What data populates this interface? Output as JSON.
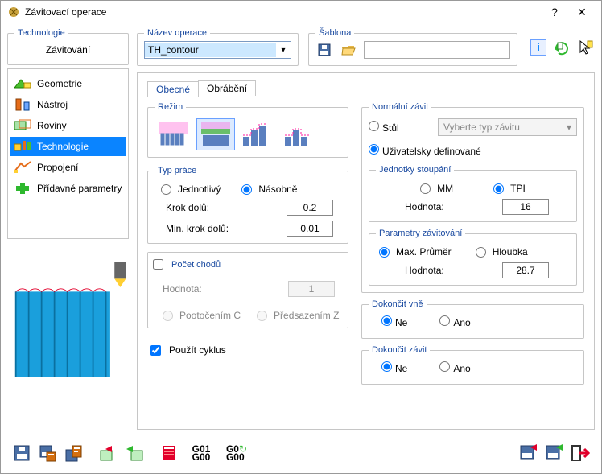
{
  "window": {
    "title": "Závitovací operace"
  },
  "tech_group": {
    "legend": "Technologie",
    "label": "Závitování"
  },
  "tree": {
    "items": [
      {
        "label": "Geometrie"
      },
      {
        "label": "Nástroj"
      },
      {
        "label": "Roviny"
      },
      {
        "label": "Technologie"
      },
      {
        "label": "Propojení"
      },
      {
        "label": "Přídavné parametry"
      }
    ]
  },
  "nazev": {
    "legend": "Název operace",
    "value": "TH_contour"
  },
  "sablona": {
    "legend": "Šablona"
  },
  "tabs": {
    "general": "Obecné",
    "machining": "Obrábění"
  },
  "rezim": {
    "legend": "Režim"
  },
  "typprace": {
    "legend": "Typ práce",
    "single": "Jednotlivý",
    "multi": "Násobně",
    "krok_label": "Krok dolů:",
    "krok_value": "0.2",
    "minkrok_label": "Min. krok dolů:",
    "minkrok_value": "0.01"
  },
  "chody": {
    "legend": "Počet chodů",
    "hodnota_label": "Hodnota:",
    "hodnota_value": "1",
    "poot": "Pootočením C",
    "pred": "Předsazením Z"
  },
  "use_cycle": "Použít cyklus",
  "normalni": {
    "legend": "Normální závit",
    "stul": "Stůl",
    "typ_placeholder": "Vyberte typ závitu",
    "user": "Uživatelsky definované"
  },
  "jednotky": {
    "legend": "Jednotky stoupání",
    "mm": "MM",
    "tpi": "TPI",
    "hodnota_label": "Hodnota:",
    "hodnota_value": "16"
  },
  "param": {
    "legend": "Parametry závitování",
    "max": "Max. Průměr",
    "depth": "Hloubka",
    "hodnota_label": "Hodnota:",
    "hodnota_value": "28.7"
  },
  "dokoncit_vne": {
    "legend": "Dokončit vně",
    "no": "Ne",
    "yes": "Ano"
  },
  "dokoncit_zavit": {
    "legend": "Dokončit závit",
    "no": "Ne",
    "yes": "Ano"
  }
}
